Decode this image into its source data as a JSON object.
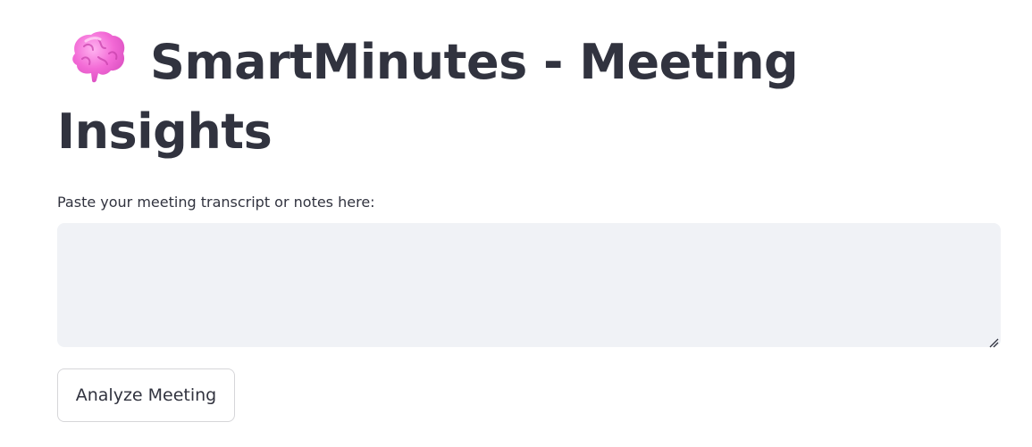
{
  "header": {
    "title": "SmartMinutes - Meeting Insights",
    "icon": "brain-icon"
  },
  "transcript": {
    "label": "Paste your meeting transcript or notes here:",
    "value": "",
    "placeholder": ""
  },
  "actions": {
    "analyze_label": "Analyze Meeting"
  },
  "colors": {
    "text": "#31333f",
    "input_bg": "#f0f2f6",
    "button_border": "#d6d6d9",
    "brain_pink": "#f06fd8"
  }
}
